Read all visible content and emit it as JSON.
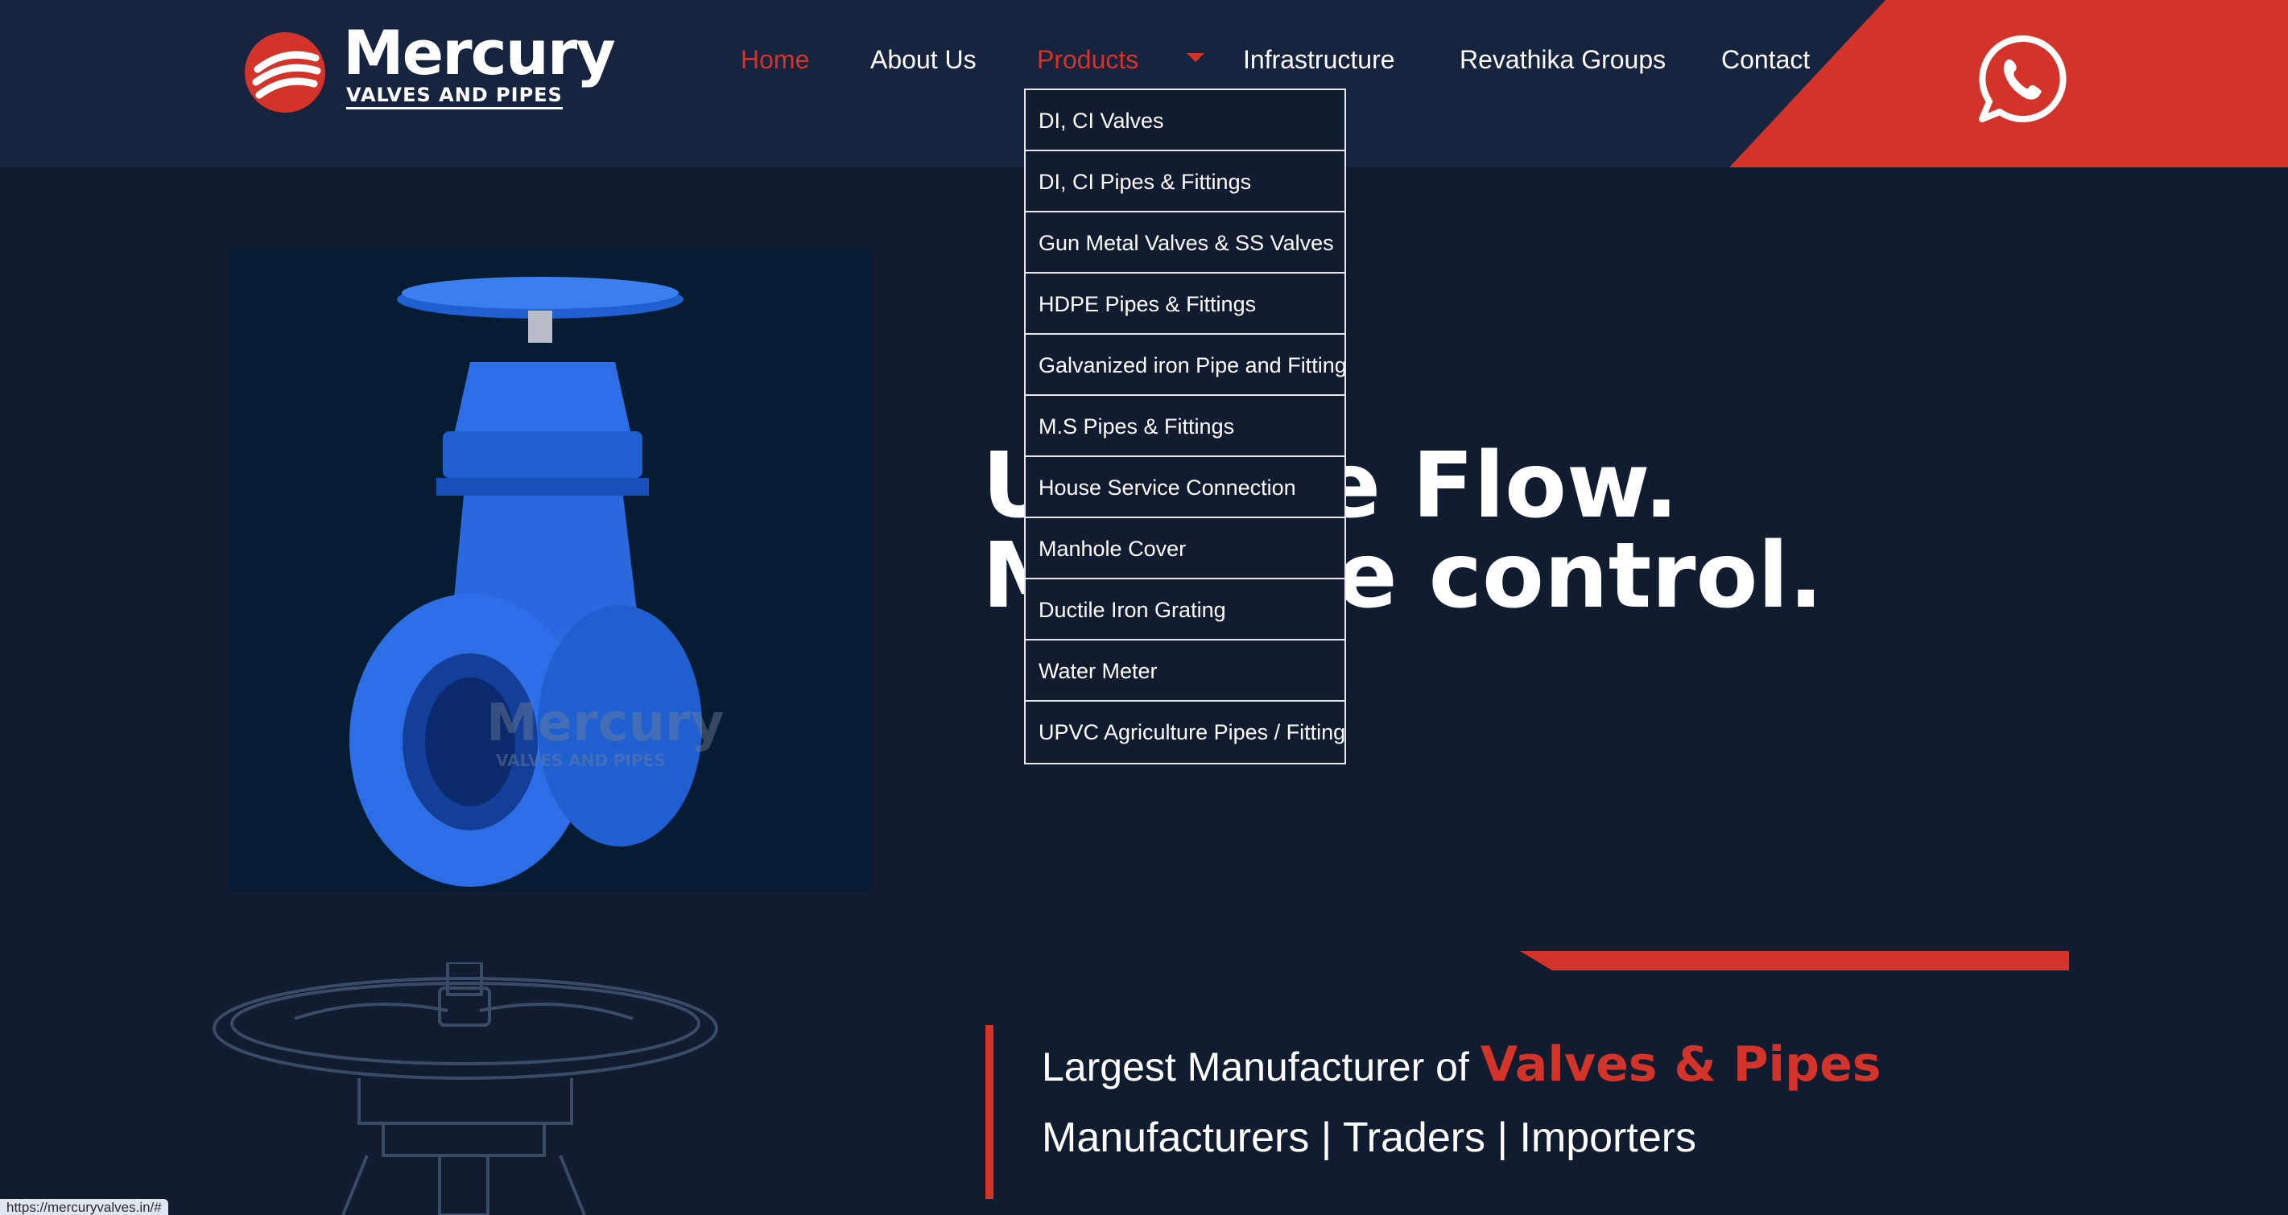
{
  "brand": {
    "name": "Mercury",
    "tagline": "VALVES AND PIPES",
    "accent_color": "#d4332a",
    "header_bg": "#172440",
    "page_bg": "#111c30"
  },
  "nav": {
    "home": "Home",
    "about": "About Us",
    "products": "Products",
    "infrastructure": "Infrastructure",
    "groups": "Revathika Groups",
    "contact": "Contact"
  },
  "products_menu": [
    "DI, CI Valves",
    "DI, CI Pipes & Fittings",
    "Gun Metal Valves & SS Valves",
    "HDPE Pipes & Fittings",
    "Galvanized iron Pipe and Fittings",
    "M.S Pipes & Fittings",
    "House Service Connection",
    "Manhole Cover",
    "Ductile Iron Grating",
    "Water Meter",
    "UPVC Agriculture Pipes / Fittings"
  ],
  "hero": {
    "line1": "U     the Flow.",
    "line2": "M     the control.",
    "watermark_name": "Mercury",
    "watermark_tag": "VALVES AND PIPES"
  },
  "about": {
    "lead": "Largest Manufacturer of",
    "highlight": "Valves & Pipes",
    "sub": "Manufacturers | Traders | Importers"
  },
  "icons": {
    "whatsapp": "whatsapp-icon",
    "dropdown": "caret-down-icon"
  },
  "status_bar": {
    "url": "https://mercuryvalves.in/#"
  }
}
